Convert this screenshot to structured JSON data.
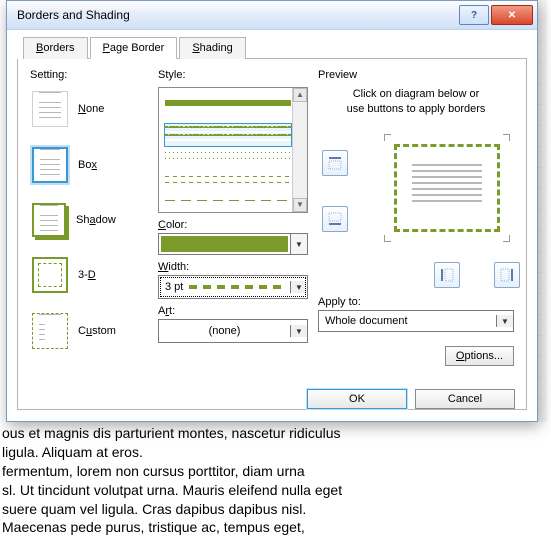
{
  "window": {
    "title": "Borders and Shading"
  },
  "tabs": {
    "borders": "Borders",
    "page_border": "Page Border",
    "shading": "Shading"
  },
  "setting": {
    "label": "Setting:",
    "none": "None",
    "box": "Box",
    "shadow": "Shadow",
    "threeD": "3-D",
    "custom": "Custom"
  },
  "style": {
    "label": "Style:",
    "color_label": "Color:",
    "width_label": "Width:",
    "width_value": "3 pt",
    "art_label": "Art:",
    "art_value": "(none)"
  },
  "preview": {
    "label": "Preview",
    "hint_line1": "Click on diagram below or",
    "hint_line2": "use buttons to apply borders",
    "apply_label": "Apply to:",
    "apply_value": "Whole document",
    "options": "Options..."
  },
  "buttons": {
    "ok": "OK",
    "cancel": "Cancel"
  },
  "background_text": "ous et magnis dis parturient montes, nascetur ridiculus\nligula. Aliquam at eros.\nfermentum, lorem non cursus porttitor, diam urna\nsl. Ut tincidunt volutpat urna. Mauris eleifend nulla eget\nsuere quam vel ligula. Cras dapibus dapibus nisl.\nMaecenas pede purus, tristique ac, tempus eget,"
}
